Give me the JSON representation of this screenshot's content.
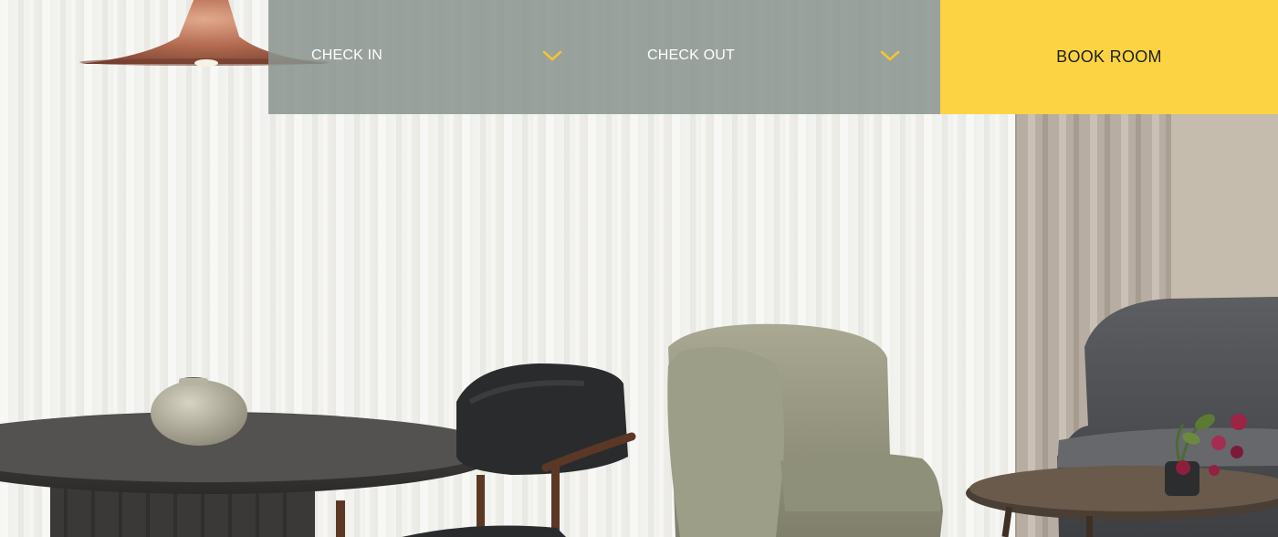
{
  "booking": {
    "check_in_label": "CHECK IN",
    "check_out_label": "CHECK OUT",
    "book_label": "BOOK ROOM",
    "dropdown_icon": "chevron-down-icon"
  },
  "colors": {
    "field_background": "#8a948f",
    "accent_yellow": "#fcd443",
    "chevron": "#f2c531",
    "button_text": "#1f1f1f"
  }
}
